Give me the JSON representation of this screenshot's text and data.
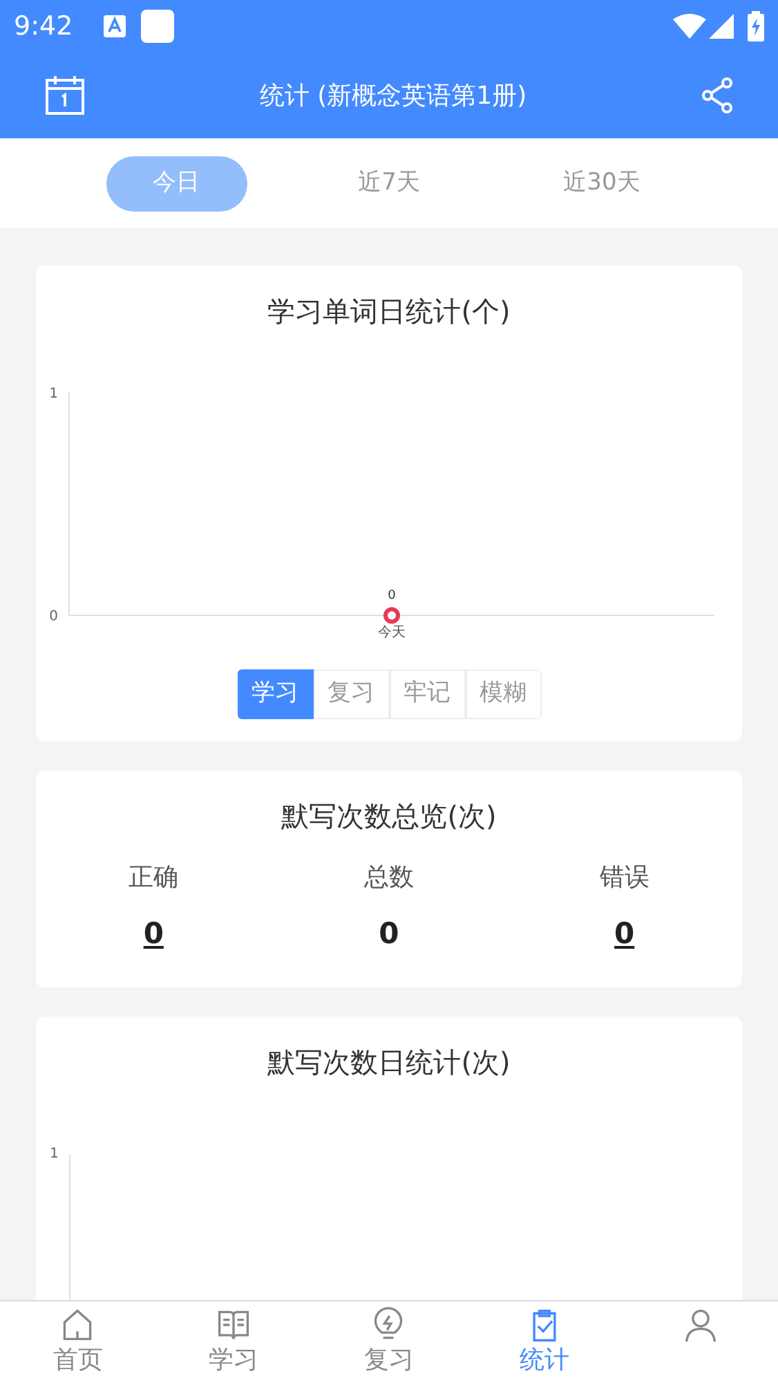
{
  "status_bar": {
    "time": "9:42"
  },
  "header": {
    "title": "统计 (新概念英语第1册)"
  },
  "period_tabs": [
    {
      "label": "今日",
      "selected": true
    },
    {
      "label": "近7天",
      "selected": false
    },
    {
      "label": "近30天",
      "selected": false
    }
  ],
  "words_card": {
    "title": "学习单词日统计(个)",
    "chart_data": {
      "type": "line",
      "categories": [
        "今天"
      ],
      "series": [
        {
          "color": "#e8385a",
          "marker": "circle",
          "values": [
            0
          ]
        }
      ],
      "yticks": [
        0,
        1
      ],
      "ylim": [
        0,
        1
      ],
      "data_labels": true
    },
    "segments": [
      {
        "label": "学习",
        "selected": true
      },
      {
        "label": "复习",
        "selected": false
      },
      {
        "label": "牢记",
        "selected": false
      },
      {
        "label": "模糊",
        "selected": false
      }
    ]
  },
  "dictation_summary": {
    "title": "默写次数总览(次)",
    "stats": [
      {
        "label": "正确",
        "value": "0",
        "link": true
      },
      {
        "label": "总数",
        "value": "0",
        "link": false
      },
      {
        "label": "错误",
        "value": "0",
        "link": true
      }
    ]
  },
  "dictation_daily": {
    "title": "默写次数日统计(次)",
    "axis_tick": "1"
  },
  "bottom_nav": [
    {
      "kind": "home",
      "label": "首页",
      "selected": false
    },
    {
      "kind": "book",
      "label": "学习",
      "selected": false
    },
    {
      "kind": "bulb",
      "label": "复习",
      "selected": false
    },
    {
      "kind": "clipboard",
      "label": "统计",
      "selected": true
    },
    {
      "kind": "person",
      "selected": false
    }
  ]
}
